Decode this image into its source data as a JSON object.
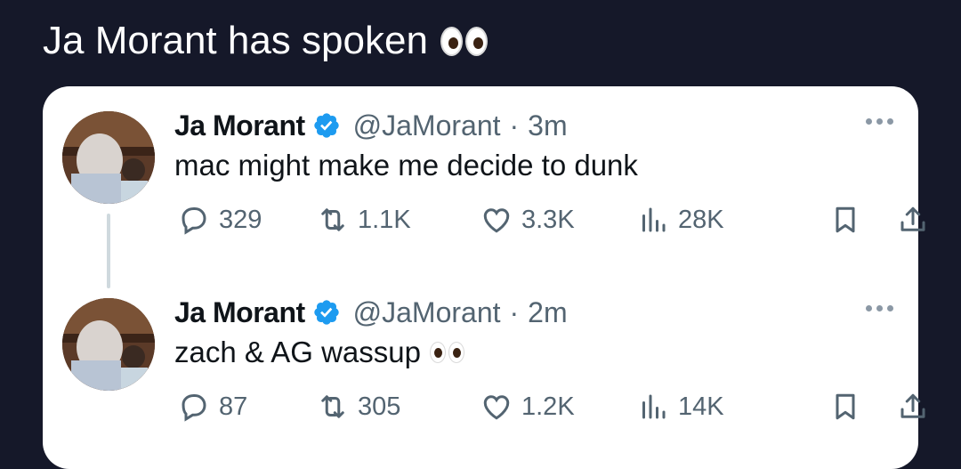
{
  "header": {
    "title": "Ja Morant has spoken",
    "emoji": "eyes-emoji"
  },
  "tweets": [
    {
      "name": "Ja Morant",
      "handle": "@JaMorant",
      "separator": "·",
      "time": "3m",
      "text": "mac might make me decide to dunk",
      "has_eyes_emoji": false,
      "replies": "329",
      "retweets": "1.1K",
      "likes": "3.3K",
      "views": "28K"
    },
    {
      "name": "Ja Morant",
      "handle": "@JaMorant",
      "separator": "·",
      "time": "2m",
      "text": "zach & AG wassup",
      "has_eyes_emoji": true,
      "replies": "87",
      "retweets": "305",
      "likes": "1.2K",
      "views": "14K"
    }
  ],
  "colors": {
    "background": "#151829",
    "card": "#ffffff",
    "verified": "#1d9bf0",
    "secondary_text": "#536471"
  },
  "icons": [
    "reply-icon",
    "retweet-icon",
    "like-icon",
    "views-icon",
    "bookmark-icon",
    "share-icon",
    "more-icon",
    "verified-badge-icon"
  ]
}
